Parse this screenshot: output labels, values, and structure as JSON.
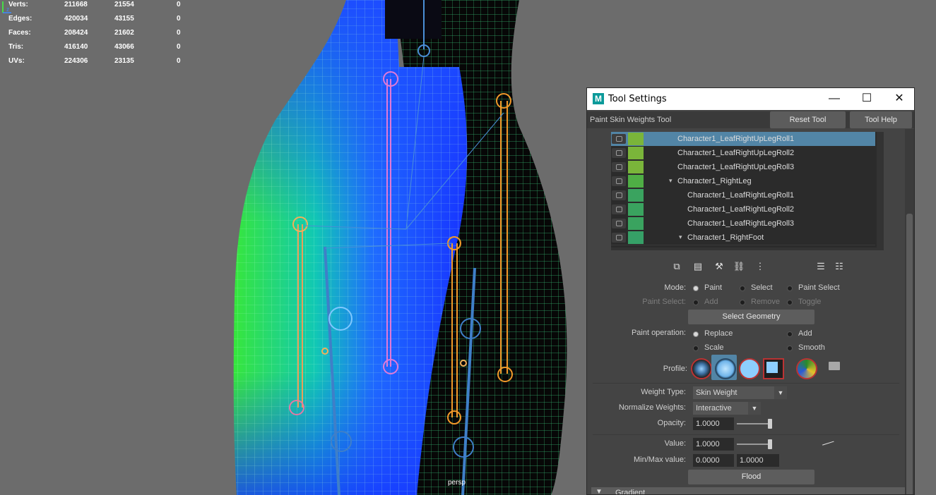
{
  "stats": [
    {
      "label": "Verts:",
      "a": "211668",
      "b": "21554",
      "c": "0"
    },
    {
      "label": "Edges:",
      "a": "420034",
      "b": "43155",
      "c": "0"
    },
    {
      "label": "Faces:",
      "a": "208424",
      "b": "21602",
      "c": "0"
    },
    {
      "label": "Tris:",
      "a": "416140",
      "b": "43066",
      "c": "0"
    },
    {
      "label": "UVs:",
      "a": "224306",
      "b": "23135",
      "c": "0"
    }
  ],
  "viewport": {
    "camera_label": "persp",
    "axis_label": "z"
  },
  "window": {
    "app_icon": "M",
    "title": "Tool Settings",
    "minimize": "—",
    "maximize": "☐",
    "close": "✕",
    "tool_name": "Paint Skin Weights Tool",
    "reset_tool": "Reset Tool",
    "tool_help": "Tool Help"
  },
  "influences": [
    {
      "name": "Character1_LeafRightUpLegRoll1",
      "color": "#7ab53a",
      "selected": true,
      "expander": ""
    },
    {
      "name": "Character1_LeafRightUpLegRoll2",
      "color": "#7ab53a",
      "selected": false,
      "expander": ""
    },
    {
      "name": "Character1_LeafRightUpLegRoll3",
      "color": "#7ab53a",
      "selected": false,
      "expander": ""
    },
    {
      "name": "Character1_RightLeg",
      "color": "#4fae45",
      "selected": false,
      "expander": "▾"
    },
    {
      "name": "Character1_LeafRightLegRoll1",
      "color": "#3aa35f",
      "selected": false,
      "expander": ""
    },
    {
      "name": "Character1_LeafRightLegRoll2",
      "color": "#3aa35f",
      "selected": false,
      "expander": ""
    },
    {
      "name": "Character1_LeafRightLegRoll3",
      "color": "#3aa35f",
      "selected": false,
      "expander": ""
    },
    {
      "name": "Character1_RightFoot",
      "color": "#36a067",
      "selected": false,
      "expander": "▾"
    }
  ],
  "mode": {
    "label": "Mode:",
    "options": [
      "Paint",
      "Select",
      "Paint Select"
    ],
    "selected": "Paint"
  },
  "paint_select": {
    "label": "Paint Select:",
    "options": [
      "Add",
      "Remove",
      "Toggle"
    ]
  },
  "select_geometry": "Select Geometry",
  "paint_operation": {
    "label": "Paint operation:",
    "options": [
      "Replace",
      "Add",
      "Scale",
      "Smooth"
    ],
    "selected": "Replace"
  },
  "profile": {
    "label": "Profile:",
    "folder_icon": "folder-icon"
  },
  "weight_type": {
    "label": "Weight Type:",
    "value": "Skin Weight"
  },
  "normalize": {
    "label": "Normalize Weights:",
    "value": "Interactive"
  },
  "opacity": {
    "label": "Opacity:",
    "value": "1.0000",
    "level": 1.0
  },
  "value": {
    "label": "Value:",
    "value": "1.0000",
    "level": 1.0
  },
  "minmax": {
    "label": "Min/Max value:",
    "min": "0.0000",
    "max": "1.0000"
  },
  "flood": "Flood",
  "gradient": {
    "label": "Gradient",
    "arrow": "▼"
  },
  "colors": {
    "selected_row": "#5285a6",
    "window_bg": "#444444",
    "viewport_bg": "#6c6c6c"
  }
}
